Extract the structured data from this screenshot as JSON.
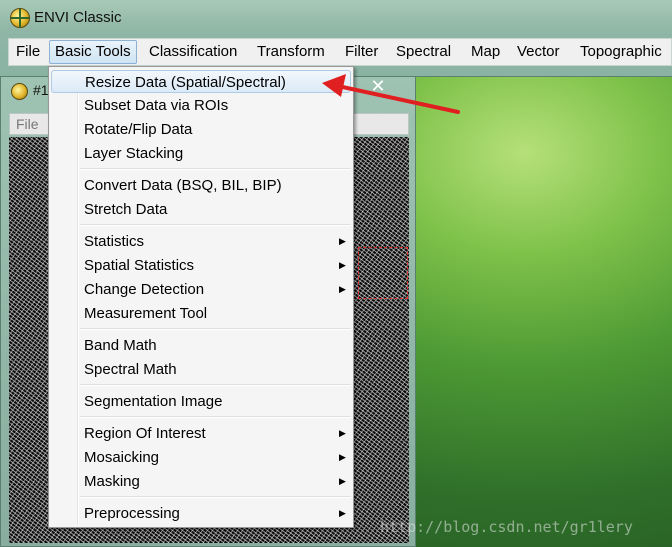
{
  "window": {
    "title": "ENVI Classic"
  },
  "menubar": {
    "items": [
      "File",
      "Basic Tools",
      "Classification",
      "Transform",
      "Filter",
      "Spectral",
      "Map",
      "Vector",
      "Topographic"
    ],
    "active": "Basic Tools"
  },
  "image_window": {
    "title": "#1",
    "menu_file": "File",
    "close_glyph": "✕"
  },
  "dropdown": {
    "groups": [
      [
        {
          "label": "Resize Data (Spatial/Spectral)",
          "submenu": false,
          "highlighted": true
        },
        {
          "label": "Subset Data via ROIs",
          "submenu": false
        },
        {
          "label": "Rotate/Flip Data",
          "submenu": false
        },
        {
          "label": "Layer Stacking",
          "submenu": false
        }
      ],
      [
        {
          "label": "Convert Data (BSQ, BIL, BIP)",
          "submenu": false
        },
        {
          "label": "Stretch Data",
          "submenu": false
        }
      ],
      [
        {
          "label": "Statistics",
          "submenu": true
        },
        {
          "label": "Spatial Statistics",
          "submenu": true
        },
        {
          "label": "Change Detection",
          "submenu": true
        },
        {
          "label": "Measurement Tool",
          "submenu": false
        }
      ],
      [
        {
          "label": "Band Math",
          "submenu": false
        },
        {
          "label": "Spectral Math",
          "submenu": false
        }
      ],
      [
        {
          "label": "Segmentation Image",
          "submenu": false
        }
      ],
      [
        {
          "label": "Region Of Interest",
          "submenu": true
        },
        {
          "label": "Mosaicking",
          "submenu": true
        },
        {
          "label": "Masking",
          "submenu": true
        }
      ],
      [
        {
          "label": "Preprocessing",
          "submenu": true
        }
      ]
    ]
  },
  "submenu_arrow_glyph": "▶",
  "watermark": "http://blog.csdn.net/gr1lery",
  "colors": {
    "annotation_arrow": "#e02020",
    "menu_highlight": "#dbeaf7"
  }
}
